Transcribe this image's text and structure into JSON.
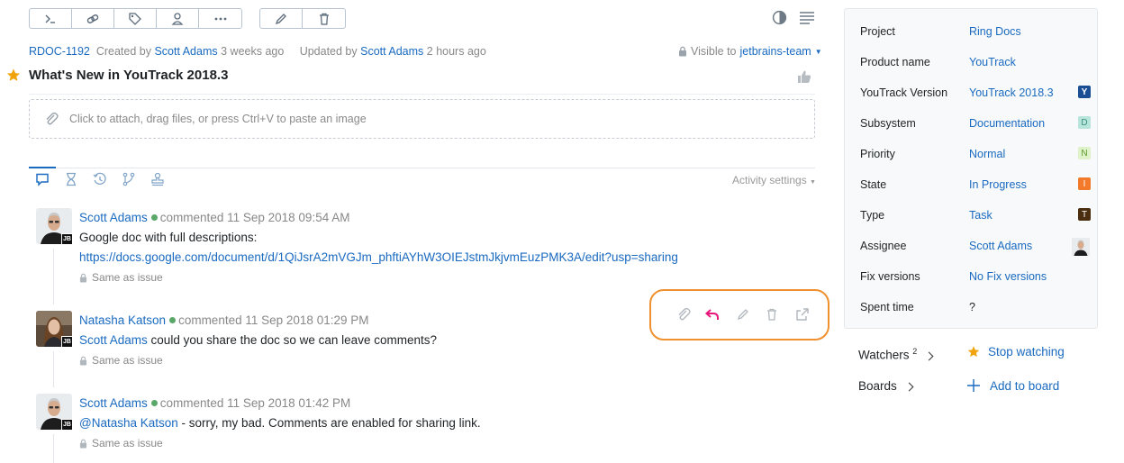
{
  "issue": {
    "id": "RDOC-1192",
    "created_prefix": "Created by",
    "created_by": "Scott Adams",
    "created_ago": "3 weeks ago",
    "updated_prefix": "Updated by",
    "updated_by": "Scott Adams",
    "updated_ago": "2 hours ago",
    "visibility_prefix": "Visible to",
    "visibility_group": "jetbrains-team",
    "title": "What's New in YouTrack 2018.3",
    "attach_hint": "Click to attach, drag files, or press Ctrl+V to paste an image"
  },
  "toolbar": {
    "left_icons": [
      "command-icon",
      "link-icon",
      "tag-icon",
      "user-icon",
      "more-icon"
    ],
    "right_icons": [
      "edit-icon",
      "delete-icon"
    ]
  },
  "activity": {
    "settings_label": "Activity settings",
    "tabs": [
      "comments-tab-icon",
      "work-items-tab-icon",
      "history-tab-icon",
      "vcs-tab-icon",
      "all-activity-tab-icon"
    ]
  },
  "comments": [
    {
      "author": "Scott Adams",
      "verb": "commented",
      "date": "11 Sep 2018 09:54 AM",
      "line1": "Google doc with full descriptions:",
      "link": "https://docs.google.com/document/d/1QiJsrA2mVGJm_phftiAYhW3OIEJstmJkjvmEuzPMK3A/edit?usp=sharing",
      "visibility": "Same as issue"
    },
    {
      "author": "Natasha Katson",
      "verb": "commented",
      "date": "11 Sep 2018 01:29 PM",
      "mention": "Scott Adams",
      "text": " could you share the doc so we can leave comments?",
      "visibility": "Same as issue"
    },
    {
      "author": "Scott Adams",
      "verb": "commented",
      "date": "11 Sep 2018 01:42 PM",
      "mention": "@Natasha Katson",
      "text": " - sorry, my bad. Comments are enabled for sharing link.",
      "visibility": "Same as issue"
    }
  ],
  "avatar_badge": "JB",
  "comment_actions": [
    "attach-icon",
    "reply-icon",
    "edit-comment-icon",
    "delete-comment-icon",
    "permalink-icon"
  ],
  "fields": [
    {
      "name": "Project",
      "value": "Ring Docs"
    },
    {
      "name": "Product name",
      "value": "YouTrack"
    },
    {
      "name": "YouTrack Version",
      "value": "YouTrack 2018.3",
      "badge": "Y",
      "badge_bg": "#1a4f96",
      "badge_fg": "#ffffff"
    },
    {
      "name": "Subsystem",
      "value": "Documentation",
      "badge": "D",
      "badge_bg": "#b7e5dc",
      "badge_fg": "#3a8f7f"
    },
    {
      "name": "Priority",
      "value": "Normal",
      "badge": "N",
      "badge_bg": "#e0f2c9",
      "badge_fg": "#5c9a2a"
    },
    {
      "name": "State",
      "value": "In Progress",
      "badge": "I",
      "badge_bg": "#f37a2a",
      "badge_fg": "#ffffff"
    },
    {
      "name": "Type",
      "value": "Task",
      "badge": "T",
      "badge_bg": "#4b2e10",
      "badge_fg": "#ffffff"
    },
    {
      "name": "Assignee",
      "value": "Scott Adams"
    },
    {
      "name": "Fix versions",
      "value": "No Fix versions"
    },
    {
      "name": "Spent time",
      "value": "?"
    }
  ],
  "watchers": {
    "label": "Watchers",
    "count": "2",
    "action": "Stop watching"
  },
  "boards": {
    "label": "Boards",
    "action": "Add to board"
  },
  "colors": {
    "accent": "#1a6ac0",
    "star": "#f0a30a",
    "reply": "#e8157b",
    "highlight": "#f0902e",
    "online": "#59a869"
  }
}
